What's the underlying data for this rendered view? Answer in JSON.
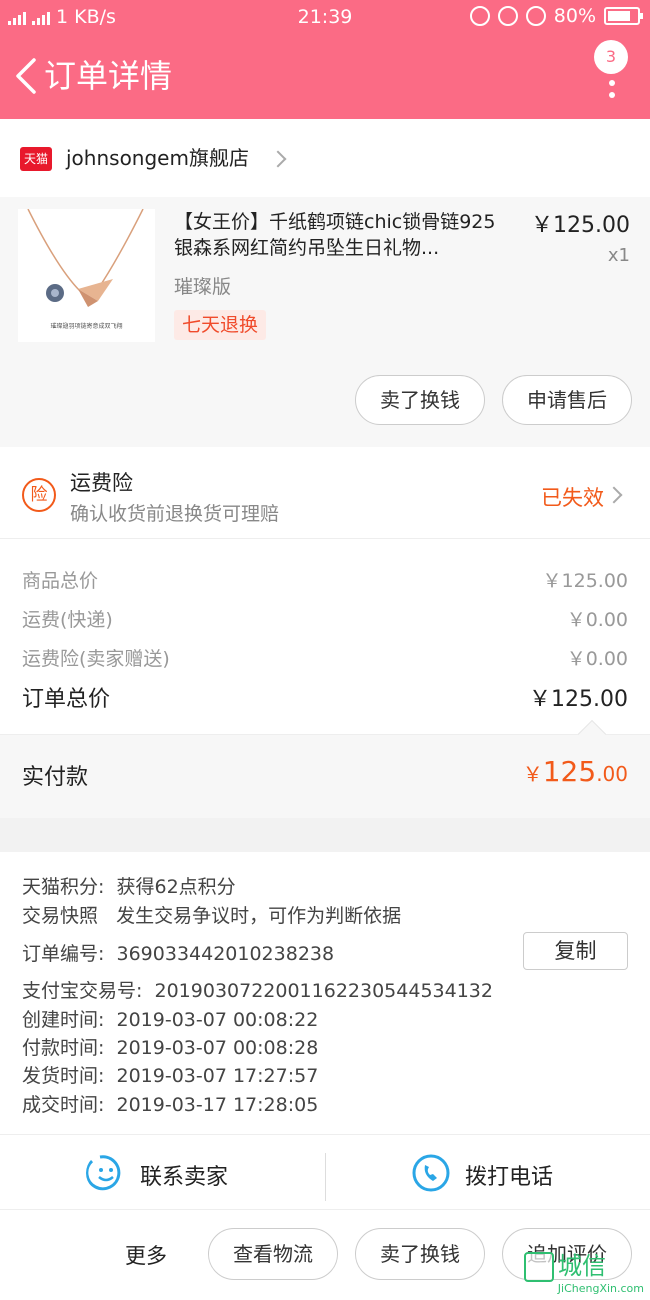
{
  "status_bar": {
    "net_speed": "1 KB/s",
    "time": "21:39",
    "battery": "80%",
    "battery_level": 0.8,
    "network_labels": [
      "2G",
      "4G"
    ]
  },
  "header": {
    "title": "订单详情",
    "badge": "3"
  },
  "shop": {
    "logo_text": "天猫",
    "name": "johnsongem旗舰店"
  },
  "product": {
    "name": "【女王价】千纸鹤项链chic锁骨链925银森系网红简约吊坠生日礼物...",
    "price": "￥125.00",
    "qty": "x1",
    "spec": "璀璨版",
    "tag": "七天退换",
    "btn_sell": "卖了换钱",
    "btn_after_sale": "申请售后",
    "image_caption": "璀璨翅羽项链寄意成双飞翔"
  },
  "insurance": {
    "icon_text": "险",
    "title": "运费险",
    "subtitle": "确认收货前退换货可理赔",
    "status": "已失效"
  },
  "costs": {
    "rows": [
      {
        "label": "商品总价",
        "value": "￥125.00"
      },
      {
        "label": "运费(快递)",
        "value": "￥0.00"
      },
      {
        "label": "运费险(卖家赠送)",
        "value": "￥0.00"
      }
    ],
    "total_label": "订单总价",
    "total_value": "￥125.00"
  },
  "paid": {
    "label": "实付款",
    "currency": "￥",
    "integer": "125",
    "decimal": ".00"
  },
  "info": {
    "points_label": "天猫积分:",
    "points_value": "获得62点积分",
    "snapshot_label": "交易快照",
    "snapshot_value": "发生交易争议时，可作为判断依据",
    "order_no_label": "订单编号:",
    "order_no": "369033442010238238",
    "copy_label": "复制",
    "alipay_label": "支付宝交易号:",
    "alipay_no": "2019030722001162230544534132",
    "created_label": "创建时间:",
    "created": "2019-03-07 00:08:22",
    "paid_label": "付款时间:",
    "paid": "2019-03-07 00:08:28",
    "shipped_label": "发货时间:",
    "shipped": "2019-03-07 17:27:57",
    "done_label": "成交时间:",
    "done": "2019-03-17 17:28:05"
  },
  "contact": {
    "seller": "联系卖家",
    "call": "拨打电话"
  },
  "bottom": {
    "more": "更多",
    "logistics": "查看物流",
    "sell": "卖了换钱",
    "review": "追加评价"
  },
  "watermark": {
    "text": "城信",
    "url": "JiChengXin.com"
  },
  "colors": {
    "brand": "#fb6b85",
    "accent": "#f25a1a",
    "link_icon": "#2aa6e6"
  }
}
